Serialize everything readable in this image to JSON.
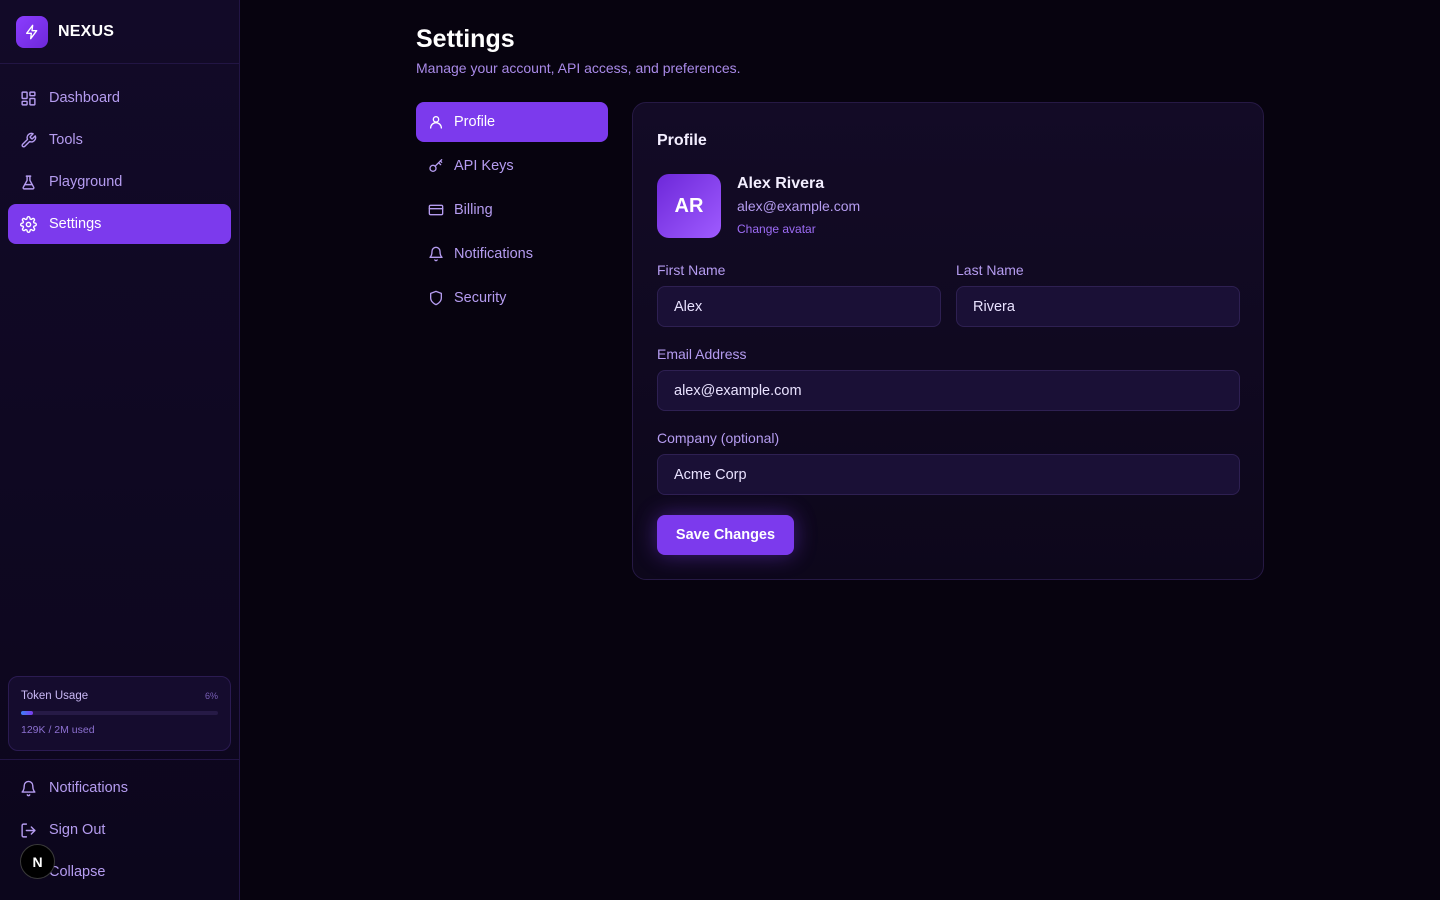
{
  "brand": {
    "name": "NEXUS"
  },
  "sidebar": {
    "items": [
      {
        "label": "Dashboard",
        "icon": "dashboard-icon"
      },
      {
        "label": "Tools",
        "icon": "wrench-icon"
      },
      {
        "label": "Playground",
        "icon": "flask-icon"
      },
      {
        "label": "Settings",
        "icon": "gear-icon",
        "active": true
      }
    ],
    "usage": {
      "title": "Token Usage",
      "percent_label": "6%",
      "fraction": 0.06,
      "used_text": "129K / 2M used"
    },
    "bottom": [
      {
        "label": "Notifications",
        "icon": "bell-icon"
      },
      {
        "label": "Sign Out",
        "icon": "sign-out-icon"
      },
      {
        "label": "Collapse",
        "icon": "collapse-icon"
      }
    ],
    "badge": "N"
  },
  "page": {
    "title": "Settings",
    "subtitle": "Manage your account, API access, and preferences."
  },
  "tabs": [
    {
      "label": "Profile",
      "icon": "user-icon",
      "active": true
    },
    {
      "label": "API Keys",
      "icon": "key-icon"
    },
    {
      "label": "Billing",
      "icon": "credit-card-icon"
    },
    {
      "label": "Notifications",
      "icon": "bell-icon"
    },
    {
      "label": "Security",
      "icon": "shield-icon"
    }
  ],
  "profile": {
    "title": "Profile",
    "initials": "AR",
    "name": "Alex Rivera",
    "email": "alex@example.com",
    "change_avatar": "Change avatar",
    "fields": {
      "first_name": {
        "label": "First Name",
        "value": "Alex"
      },
      "last_name": {
        "label": "Last Name",
        "value": "Rivera"
      },
      "email": {
        "label": "Email Address",
        "value": "alex@example.com"
      },
      "company": {
        "label": "Company (optional)",
        "value": "Acme Corp"
      }
    },
    "save_label": "Save Changes"
  },
  "colors": {
    "accent": "#7c3aed",
    "background": "#07030f",
    "sidebar": "#120a28",
    "muted_text": "#b59cf0"
  }
}
